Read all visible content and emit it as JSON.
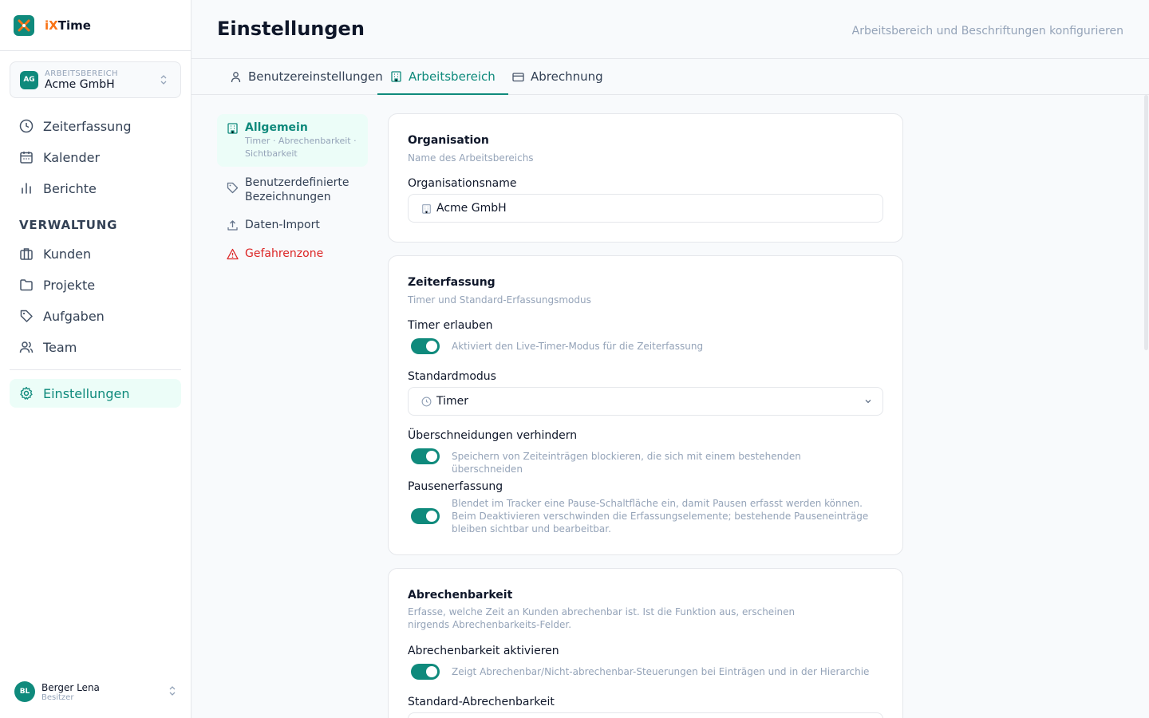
{
  "brand": {
    "prefix": "iX",
    "suffix": "Time"
  },
  "workspace": {
    "label": "ARBEITSBEREICH",
    "name": "Acme GmbH",
    "initials": "AG"
  },
  "nav": {
    "items": [
      {
        "label": "Zeiterfassung",
        "icon": "clock-icon"
      },
      {
        "label": "Kalender",
        "icon": "calendar-icon"
      },
      {
        "label": "Berichte",
        "icon": "bar-chart-icon"
      }
    ],
    "section_label": "VERWALTUNG",
    "admin_items": [
      {
        "label": "Kunden",
        "icon": "briefcase-icon"
      },
      {
        "label": "Projekte",
        "icon": "folder-icon"
      },
      {
        "label": "Aufgaben",
        "icon": "tag-icon"
      },
      {
        "label": "Team",
        "icon": "users-icon"
      }
    ],
    "settings": {
      "label": "Einstellungen",
      "icon": "gear-icon"
    }
  },
  "user": {
    "name": "Berger Lena",
    "role": "Besitzer",
    "initials": "BL"
  },
  "header": {
    "title": "Einstellungen",
    "subtitle": "Arbeitsbereich und Beschriftungen konfigurieren"
  },
  "tabs": [
    {
      "label": "Benutzereinstellungen"
    },
    {
      "label": "Arbeitsbereich"
    },
    {
      "label": "Abrechnung"
    }
  ],
  "subnav": [
    {
      "title": "Allgemein",
      "desc": "Timer · Abrechenbarkeit · Sichtbarkeit"
    },
    {
      "title": "Benutzerdefinierte Bezeichnungen"
    },
    {
      "title": "Daten-Import"
    },
    {
      "title": "Gefahrenzone"
    }
  ],
  "organisation": {
    "title": "Organisation",
    "desc": "Name des Arbeitsbereichs",
    "field_label": "Organisationsname",
    "value": "Acme GmbH"
  },
  "zeiterfassung": {
    "title": "Zeiterfassung",
    "desc": "Timer und Standard-Erfassungsmodus",
    "timer_label": "Timer erlauben",
    "timer_desc": "Aktiviert den Live-Timer-Modus für die Zeiterfassung",
    "timer_on": true,
    "mode_label": "Standardmodus",
    "mode_value": "Timer",
    "overlap_label": "Überschneidungen verhindern",
    "overlap_desc": "Speichern von Zeiteinträgen blockieren, die sich mit einem bestehenden überschneiden",
    "overlap_on": true,
    "pause_label": "Pausenerfassung",
    "pause_desc": "Blendet im Tracker eine Pause-Schaltfläche ein, damit Pausen erfasst werden können. Beim Deaktivieren verschwinden die Erfassungselemente; bestehende Pauseneinträge bleiben sichtbar und bearbeitbar.",
    "pause_on": true
  },
  "abrechenbarkeit": {
    "title": "Abrechenbarkeit",
    "desc": "Erfasse, welche Zeit an Kunden abrechenbar ist. Ist die Funktion aus, erscheinen nirgends Abrechenbarkeits-Felder.",
    "enable_label": "Abrechenbarkeit aktivieren",
    "enable_desc": "Zeigt Abrechenbar/Nicht-abrechenbar-Steuerungen bei Einträgen und in der Hierarchie",
    "enable_on": true,
    "default_label": "Standard-Abrechenbarkeit"
  },
  "colors": {
    "accent": "#0f8a7c",
    "danger": "#dc2626",
    "muted": "#94a3b8"
  }
}
